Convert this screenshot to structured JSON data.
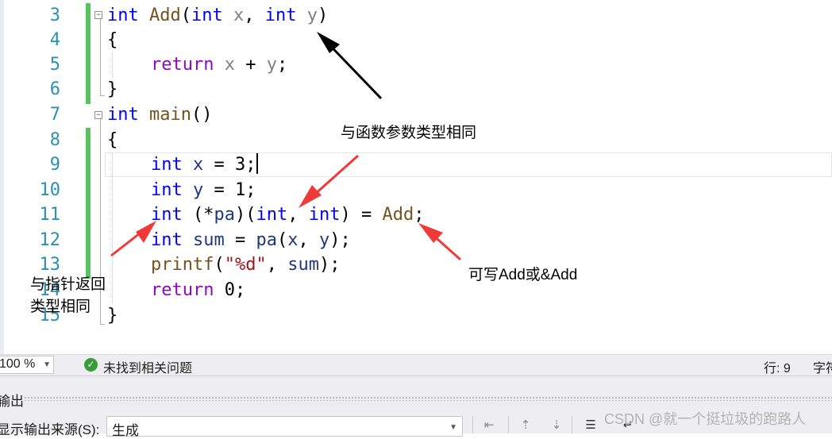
{
  "editor": {
    "line_numbers": [
      "3",
      "4",
      "5",
      "6",
      "7",
      "8",
      "9",
      "10",
      "11",
      "12",
      "13",
      "14",
      "15"
    ],
    "keywords": {
      "int": "int",
      "return": "return",
      "printf": "printf"
    },
    "identifiers": {
      "add": "Add",
      "main": "main",
      "x": "x",
      "y": "y",
      "pa": "pa",
      "sum": "sum"
    },
    "literals": {
      "three": "3",
      "one": "1",
      "zero": "0",
      "format": "\"%d\""
    },
    "fold_glyph": "⊟"
  },
  "annotations": {
    "param_type_note": "与函数参数类型相同",
    "return_type_note_line1": "与指针返回",
    "return_type_note_line2": "类型相同",
    "add_note": "可写Add或&Add"
  },
  "annotation_arrow_colors": {
    "black": "#000000",
    "red": "#f03a3a"
  },
  "statusbar": {
    "zoom": "100 %",
    "issues_icon": "check-circle-icon",
    "issues_text": "未找到相关问题",
    "row": "行: 9",
    "char": "字符"
  },
  "output_panel": {
    "title": "输出",
    "source_label": "显示输出来源(S):",
    "source_value": "生成"
  },
  "watermark": "CSDN @就一个挺垃圾的跑路人",
  "colors": {
    "keyword": "#0000ff",
    "function": "#74531f",
    "parameter": "#808080",
    "control": "#8f08c4",
    "variable": "#1f377f",
    "string": "#a31515",
    "line_number": "#2b91af",
    "change_bar": "#57c35f"
  }
}
